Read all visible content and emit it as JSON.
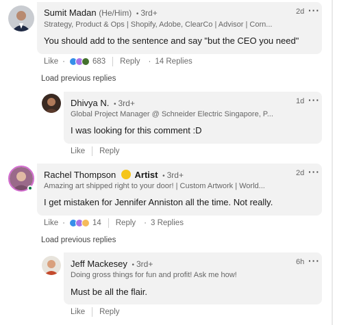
{
  "comments": [
    {
      "name": "Sumit Madan",
      "pronouns": "(He/Him)",
      "degree": "3rd+",
      "headline": "Strategy, Product & Ops | Shopify, Adobe, ClearCo | Advisor | Corn...",
      "time": "2d",
      "text": "You should add to the sentence and say \"but the CEO you need\"",
      "like_label": "Like",
      "reaction_count": "683",
      "reply_label": "Reply",
      "replies_label": "14 Replies"
    },
    {
      "name": "Dhivya N.",
      "degree": "3rd+",
      "headline": "Global Project Manager @ Schneider Electric Singapore, P...",
      "time": "1d",
      "text": "I was looking for this comment :D",
      "like_label": "Like",
      "reply_label": "Reply"
    },
    {
      "name": "Rachel Thompson",
      "badge_label": "Artist",
      "degree": "3rd+",
      "headline": "Amazing art shipped right to your door! | Custom Artwork | World...",
      "time": "2d",
      "text": "I get mistaken for Jennifer Anniston all the time. Not really.",
      "like_label": "Like",
      "reaction_count": "14",
      "reply_label": "Reply",
      "replies_label": "3 Replies"
    },
    {
      "name": "Jeff Mackesey",
      "degree": "3rd+",
      "headline": "Doing gross things for fun and profit! Ask me how!",
      "time": "6h",
      "text": "Must be all the flair.",
      "like_label": "Like",
      "reply_label": "Reply"
    }
  ],
  "load_previous_label": "Load previous replies",
  "colors": {
    "bubble": "#f2f2f2",
    "like_blue": "#378fe9",
    "celebrate_green": "#44712e",
    "support_purple": "#a872e8",
    "insightful_yellow": "#f5bb5c",
    "online_green": "#057642"
  },
  "icons": [
    "more-options-icon",
    "like-reaction-icon",
    "celebrate-reaction-icon",
    "support-reaction-icon",
    "artist-badge-icon"
  ]
}
